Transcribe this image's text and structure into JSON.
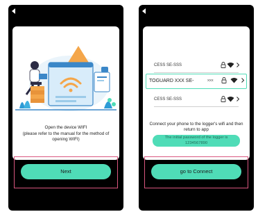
{
  "screen1": {
    "instruction_line1": "Open the device WIFI",
    "instruction_line2": "(please refer to the manual for the method of opening WIFI)",
    "next_label": "Next"
  },
  "screen2": {
    "wifi_list": [
      {
        "name": "CESS SE-SSS"
      },
      {
        "name": "TOGUARD XXX SE-",
        "extra": "xxx",
        "highlighted": true
      },
      {
        "name": "CESS SE-SSS"
      }
    ],
    "connect_instruction": "Connect your phone to the logger's wifi and then return to app",
    "password_line1": "The initial password of the logger is",
    "password_line2": "1234567890",
    "connect_label": "go to Connect"
  },
  "colors": {
    "accent": "#4fdcb7",
    "highlight_border": "#d9567f",
    "phone_bg": "#000000"
  }
}
